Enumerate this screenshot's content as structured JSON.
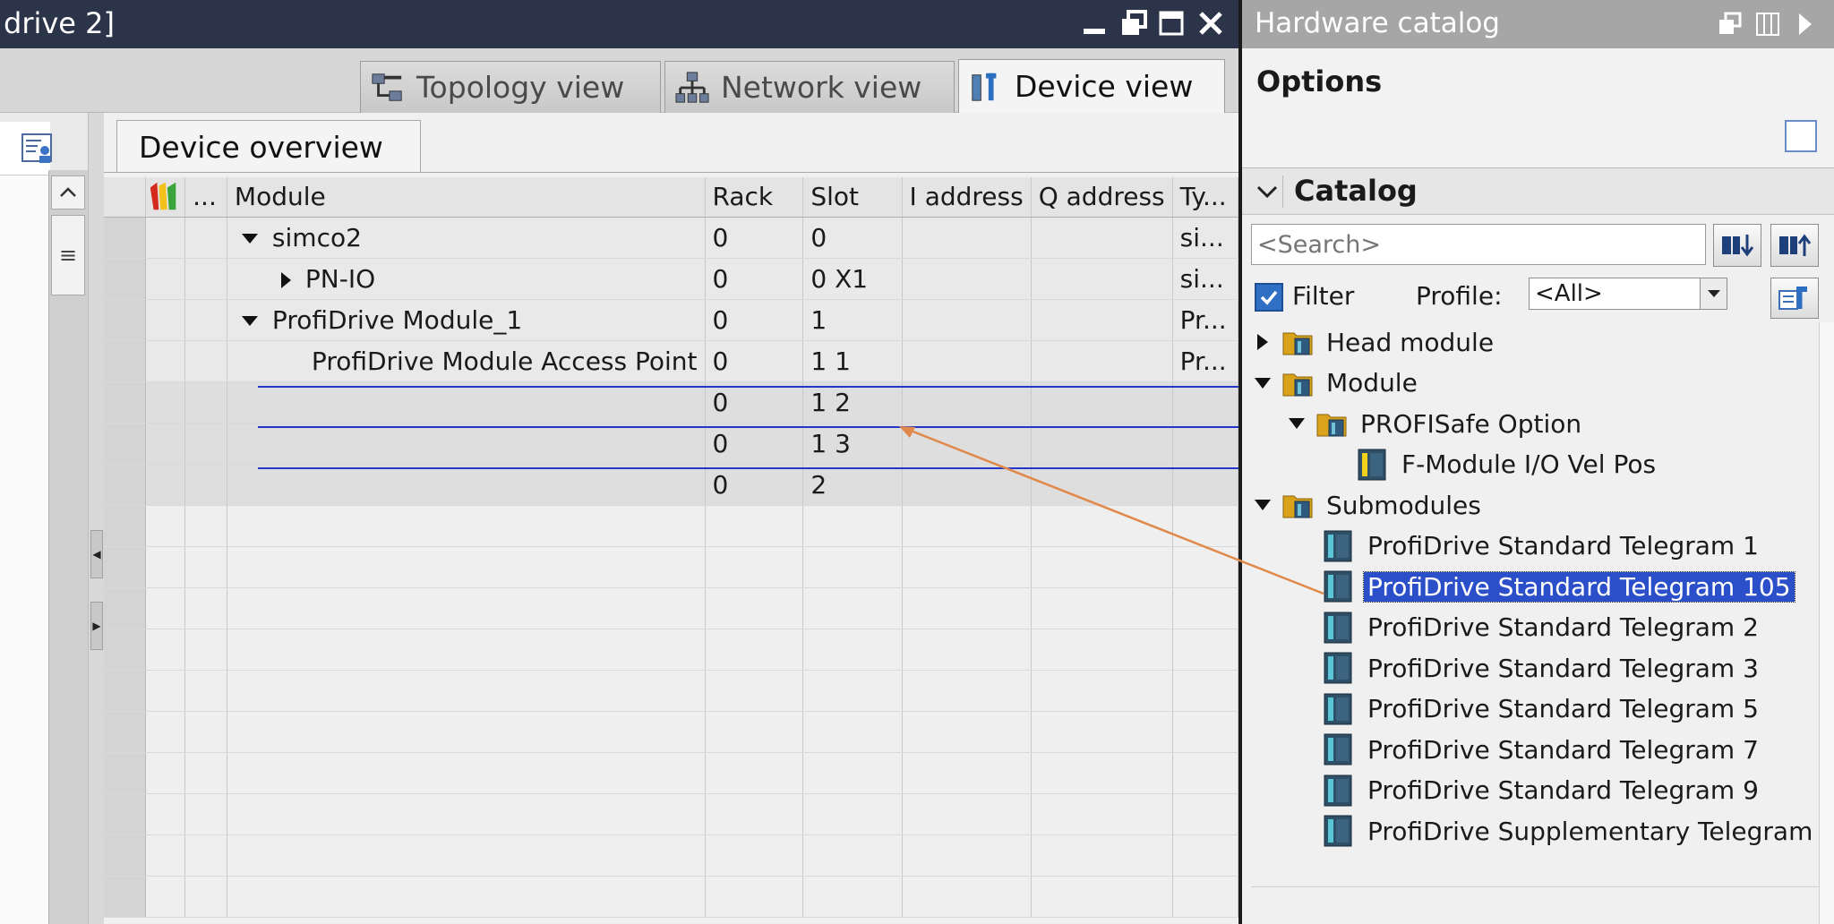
{
  "editor": {
    "title": "drive 2]",
    "tabs": [
      {
        "label": "Topology view",
        "icon": "topology-icon"
      },
      {
        "label": "Network view",
        "icon": "network-icon"
      },
      {
        "label": "Device view",
        "icon": "device-icon",
        "active": true
      }
    ],
    "overview_tab": "Device overview",
    "columns": [
      "",
      "...",
      "Module",
      "Rack",
      "Slot",
      "I address",
      "Q address",
      "Ty..."
    ],
    "rows": [
      {
        "module": "simco2",
        "expander": "down",
        "indent": 0,
        "rack": "0",
        "slot": "0",
        "i_address": "",
        "q_address": "",
        "type": "si..."
      },
      {
        "module": "PN-IO",
        "expander": "right",
        "indent": 1,
        "rack": "0",
        "slot": "0 X1",
        "i_address": "",
        "q_address": "",
        "type": "si..."
      },
      {
        "module": "ProfiDrive Module_1",
        "expander": "down",
        "indent": 0,
        "rack": "0",
        "slot": "1",
        "i_address": "",
        "q_address": "",
        "type": "Pr..."
      },
      {
        "module": "ProfiDrive Module Access Point",
        "expander": "",
        "indent": 1,
        "rack": "0",
        "slot": "1 1",
        "i_address": "",
        "q_address": "",
        "type": "Pr..."
      },
      {
        "module": "",
        "expander": "",
        "indent": 1,
        "rack": "0",
        "slot": "1 2",
        "i_address": "",
        "q_address": "",
        "type": ""
      },
      {
        "module": "",
        "expander": "",
        "indent": 1,
        "rack": "0",
        "slot": "1 3",
        "i_address": "",
        "q_address": "",
        "type": ""
      },
      {
        "module": "",
        "expander": "",
        "indent": 1,
        "rack": "0",
        "slot": "2",
        "i_address": "",
        "q_address": "",
        "type": ""
      }
    ],
    "empty_rows": 10
  },
  "catalog": {
    "title": "Hardware catalog",
    "options_label": "Options",
    "catalog_label": "Catalog",
    "search_placeholder": "<Search>",
    "filter_label": "Filter",
    "filter_checked": true,
    "profile_label": "Profile:",
    "profile_value": "<All>",
    "tree": [
      {
        "label": "Head module",
        "kind": "folder",
        "level": 0,
        "expander": "right"
      },
      {
        "label": "Module",
        "kind": "folder",
        "level": 0,
        "expander": "down"
      },
      {
        "label": "PROFISafe Option",
        "kind": "folder",
        "level": 1,
        "expander": "down"
      },
      {
        "label": "F-Module I/O Vel Pos",
        "kind": "fmodule",
        "level": 2,
        "expander": ""
      },
      {
        "label": "Submodules",
        "kind": "folder",
        "level": 0,
        "expander": "down"
      },
      {
        "label": "ProfiDrive Standard Telegram 1",
        "kind": "module",
        "level": 1,
        "expander": ""
      },
      {
        "label": "ProfiDrive Standard Telegram 105",
        "kind": "module",
        "level": 1,
        "expander": "",
        "selected": true
      },
      {
        "label": "ProfiDrive Standard Telegram 2",
        "kind": "module",
        "level": 1,
        "expander": ""
      },
      {
        "label": "ProfiDrive Standard Telegram 3",
        "kind": "module",
        "level": 1,
        "expander": ""
      },
      {
        "label": "ProfiDrive Standard Telegram 5",
        "kind": "module",
        "level": 1,
        "expander": ""
      },
      {
        "label": "ProfiDrive Standard Telegram 7",
        "kind": "module",
        "level": 1,
        "expander": ""
      },
      {
        "label": "ProfiDrive Standard Telegram 9",
        "kind": "module",
        "level": 1,
        "expander": ""
      },
      {
        "label": "ProfiDrive Supplementary Telegram",
        "kind": "module",
        "level": 1,
        "expander": ""
      }
    ]
  },
  "colors": {
    "titlebar": "#2b3448",
    "selection": "#2a4fc9",
    "insert_line": "#2336c9",
    "drag_arrow": "#e0894a"
  }
}
